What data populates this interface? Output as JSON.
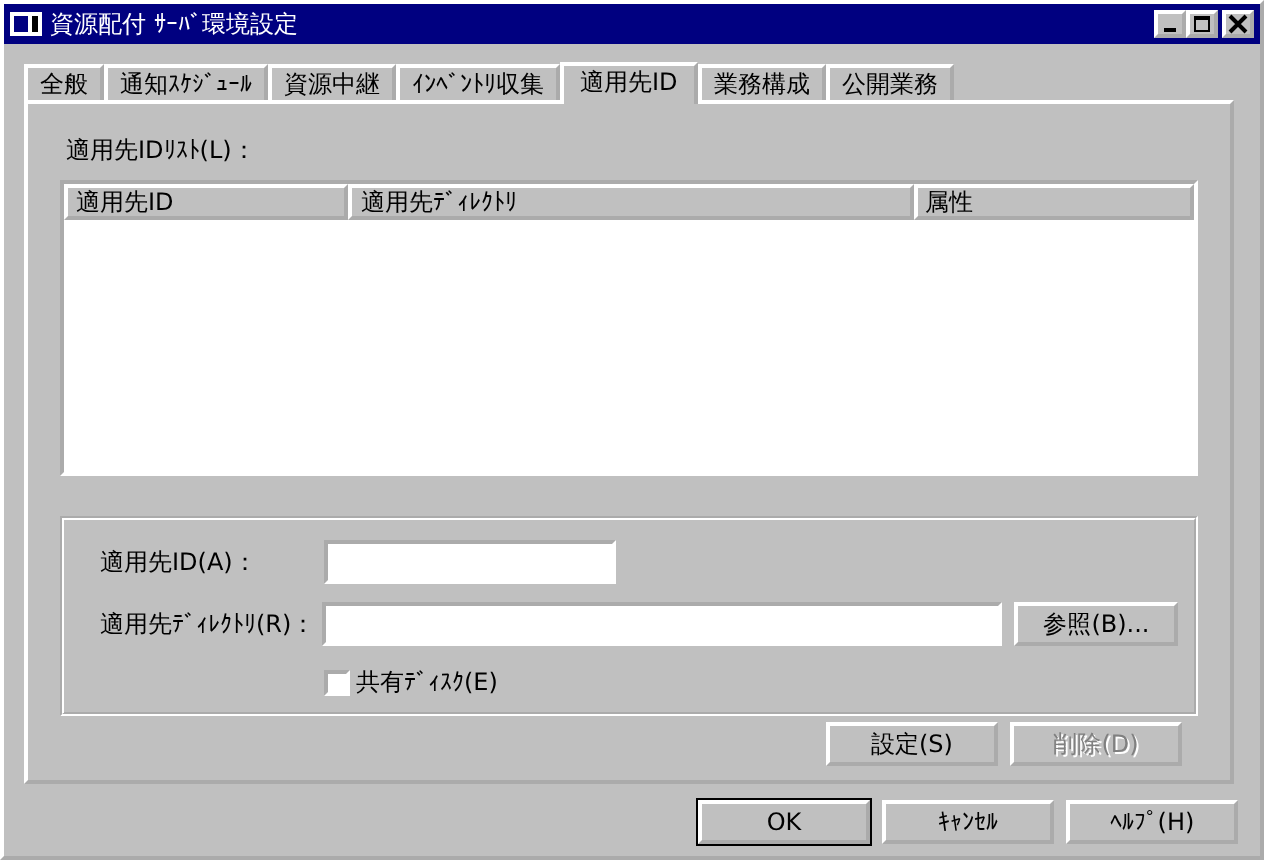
{
  "window": {
    "title": "資源配付 ｻｰﾊﾞ環境設定"
  },
  "title_buttons": [
    {
      "kind": "minimize"
    },
    {
      "kind": "maximize"
    },
    {
      "kind": "close"
    }
  ],
  "tabs": [
    {
      "label": "全般",
      "selected": false
    },
    {
      "label": "通知ｽｹｼﾞｭｰﾙ",
      "selected": false
    },
    {
      "label": "資源中継",
      "selected": false
    },
    {
      "label": "ｲﾝﾍﾞﾝﾄﾘ収集",
      "selected": false
    },
    {
      "label": "適用先ID",
      "selected": true
    },
    {
      "label": "業務構成",
      "selected": false
    },
    {
      "label": "公開業務",
      "selected": false
    }
  ],
  "list": {
    "label": "適用先IDﾘｽﾄ(L)：",
    "columns": [
      "適用先ID",
      "適用先ﾃﾞｨﾚｸﾄﾘ",
      "属性"
    ]
  },
  "form": {
    "id_label": "適用先ID(A)：",
    "dir_label": "適用先ﾃﾞｨﾚｸﾄﾘ(R)：",
    "browse_button": "参照(B)...",
    "shared_disk": {
      "label": "共有ﾃﾞｨｽｸ(E)",
      "checked": false
    }
  },
  "panel_buttons": [
    {
      "label": "設定(S)",
      "disabled": false
    },
    {
      "label": "削除(D)",
      "disabled": true
    }
  ],
  "buttons": [
    {
      "label": "OK",
      "default": true
    },
    {
      "label": "ｷｬﾝｾﾙ",
      "default": false
    },
    {
      "label": "ﾍﾙﾌﾟ(H)",
      "default": false
    }
  ]
}
